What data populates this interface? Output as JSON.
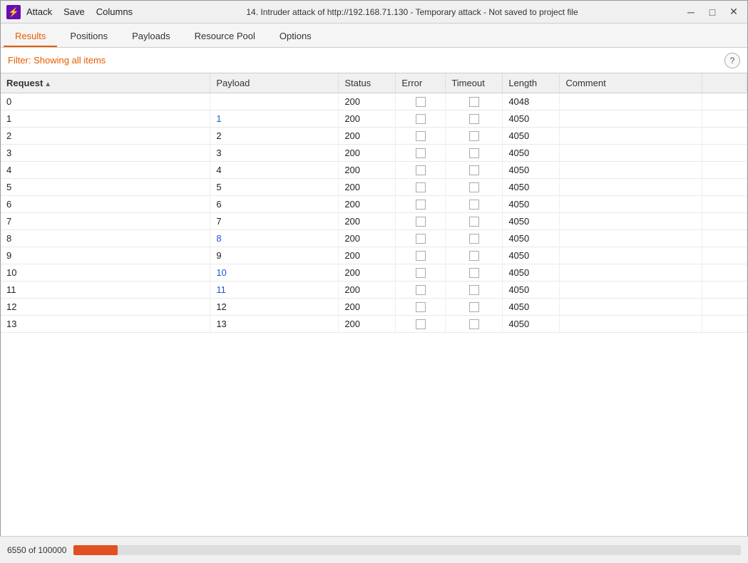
{
  "titlebar": {
    "logo": "⚡",
    "menu": [
      "Attack",
      "Save",
      "Columns"
    ],
    "title": "14. Intruder attack of http://192.168.71.130 - Temporary attack - Not saved to project file",
    "minimize": "─",
    "maximize": "□",
    "close": "✕"
  },
  "tabs": [
    {
      "id": "results",
      "label": "Results",
      "active": true
    },
    {
      "id": "positions",
      "label": "Positions",
      "active": false
    },
    {
      "id": "payloads",
      "label": "Payloads",
      "active": false
    },
    {
      "id": "resource-pool",
      "label": "Resource Pool",
      "active": false
    },
    {
      "id": "options",
      "label": "Options",
      "active": false
    }
  ],
  "filter": {
    "prefix": "Filter: ",
    "text": "Showing all items"
  },
  "help_btn": "?",
  "table": {
    "columns": [
      {
        "id": "request",
        "label": "Request",
        "sorted": true,
        "sort_dir": "asc"
      },
      {
        "id": "payload",
        "label": "Payload"
      },
      {
        "id": "status",
        "label": "Status"
      },
      {
        "id": "error",
        "label": "Error"
      },
      {
        "id": "timeout",
        "label": "Timeout"
      },
      {
        "id": "length",
        "label": "Length"
      },
      {
        "id": "comment",
        "label": "Comment"
      }
    ],
    "rows": [
      {
        "request": "0",
        "payload": "",
        "payload_link": false,
        "status": "200",
        "error": false,
        "timeout": false,
        "length": "4048",
        "comment": ""
      },
      {
        "request": "1",
        "payload": "1",
        "payload_link": true,
        "status": "200",
        "error": false,
        "timeout": false,
        "length": "4050",
        "comment": ""
      },
      {
        "request": "2",
        "payload": "2",
        "payload_link": false,
        "status": "200",
        "error": false,
        "timeout": false,
        "length": "4050",
        "comment": ""
      },
      {
        "request": "3",
        "payload": "3",
        "payload_link": false,
        "status": "200",
        "error": false,
        "timeout": false,
        "length": "4050",
        "comment": ""
      },
      {
        "request": "4",
        "payload": "4",
        "payload_link": false,
        "status": "200",
        "error": false,
        "timeout": false,
        "length": "4050",
        "comment": ""
      },
      {
        "request": "5",
        "payload": "5",
        "payload_link": false,
        "status": "200",
        "error": false,
        "timeout": false,
        "length": "4050",
        "comment": ""
      },
      {
        "request": "6",
        "payload": "6",
        "payload_link": false,
        "status": "200",
        "error": false,
        "timeout": false,
        "length": "4050",
        "comment": ""
      },
      {
        "request": "7",
        "payload": "7",
        "payload_link": false,
        "status": "200",
        "error": false,
        "timeout": false,
        "length": "4050",
        "comment": ""
      },
      {
        "request": "8",
        "payload": "8",
        "payload_link": true,
        "status": "200",
        "error": false,
        "timeout": false,
        "length": "4050",
        "comment": ""
      },
      {
        "request": "9",
        "payload": "9",
        "payload_link": false,
        "status": "200",
        "error": false,
        "timeout": false,
        "length": "4050",
        "comment": ""
      },
      {
        "request": "10",
        "payload": "10",
        "payload_link": true,
        "status": "200",
        "error": false,
        "timeout": false,
        "length": "4050",
        "comment": ""
      },
      {
        "request": "11",
        "payload": "11",
        "payload_link": true,
        "status": "200",
        "error": false,
        "timeout": false,
        "length": "4050",
        "comment": ""
      },
      {
        "request": "12",
        "payload": "12",
        "payload_link": false,
        "status": "200",
        "error": false,
        "timeout": false,
        "length": "4050",
        "comment": ""
      },
      {
        "request": "13",
        "payload": "13",
        "payload_link": false,
        "status": "200",
        "error": false,
        "timeout": false,
        "length": "4050",
        "comment": ""
      }
    ]
  },
  "statusbar": {
    "progress_text": "6550 of 100000",
    "progress_percent": 6.55
  }
}
